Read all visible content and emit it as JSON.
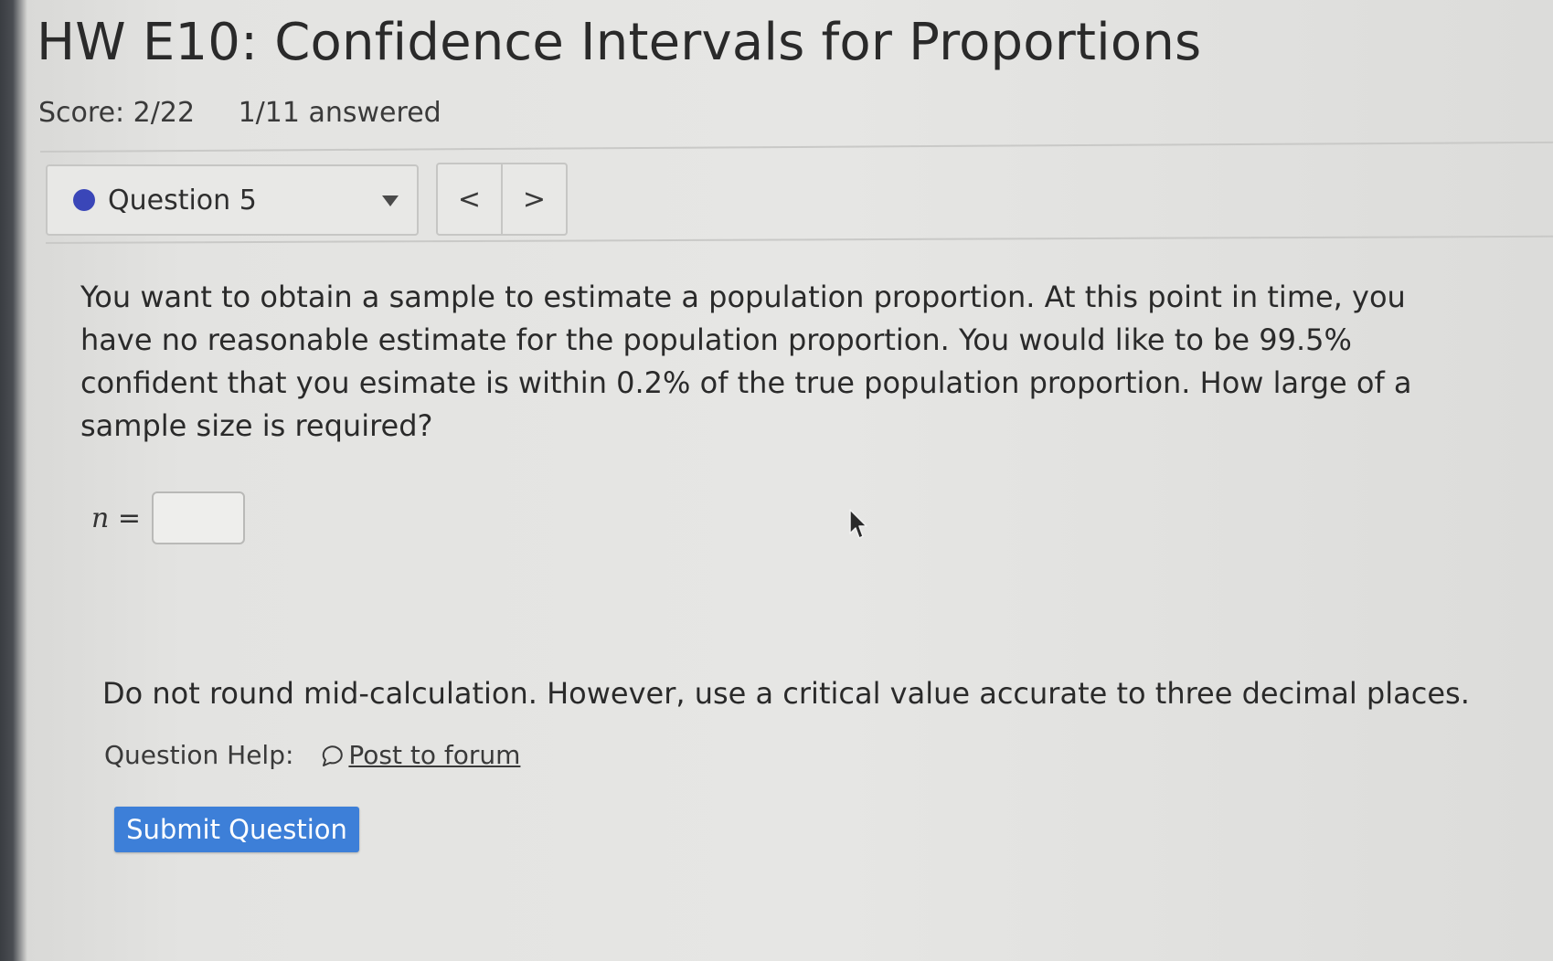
{
  "header": {
    "title": "HW E10: Confidence Intervals for Proportions",
    "score": "Score: 2/22",
    "answered": "1/11 answered"
  },
  "question_nav": {
    "selected": "Question 5",
    "status_dot_color": "#3a46b8",
    "prev_symbol": "<",
    "next_symbol": ">"
  },
  "question": {
    "text": "You want to obtain a sample to estimate a population proportion. At this point in time, you have no reasonable estimate for the population proportion. You would like to be 99.5% confident that you esimate is within 0.2% of the true population proportion. How large of a sample size is required?",
    "answer_var": "n",
    "answer_eq": "=",
    "answer_value": "",
    "note": "Do not round mid-calculation. However, use a critical value accurate to three decimal places."
  },
  "help": {
    "label": "Question Help:",
    "forum_link": "Post to forum"
  },
  "actions": {
    "submit_label": "Submit Question",
    "submit_color": "#3d7fd8"
  }
}
